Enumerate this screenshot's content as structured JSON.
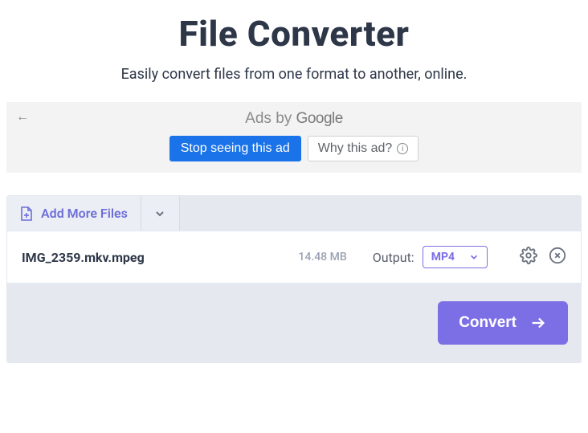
{
  "header": {
    "title": "File Converter",
    "subtitle": "Easily convert files from one format to another, online."
  },
  "ad": {
    "byline_prefix": "Ads by ",
    "byline_brand": "Google",
    "stop_label": "Stop seeing this ad",
    "why_label": "Why this ad?"
  },
  "toolbar": {
    "add_more_label": "Add More Files"
  },
  "file": {
    "name": "IMG_2359.mkv.mpeg",
    "size": "14.48 MB",
    "output_label": "Output:",
    "output_value": "MP4"
  },
  "actions": {
    "convert_label": "Convert"
  }
}
